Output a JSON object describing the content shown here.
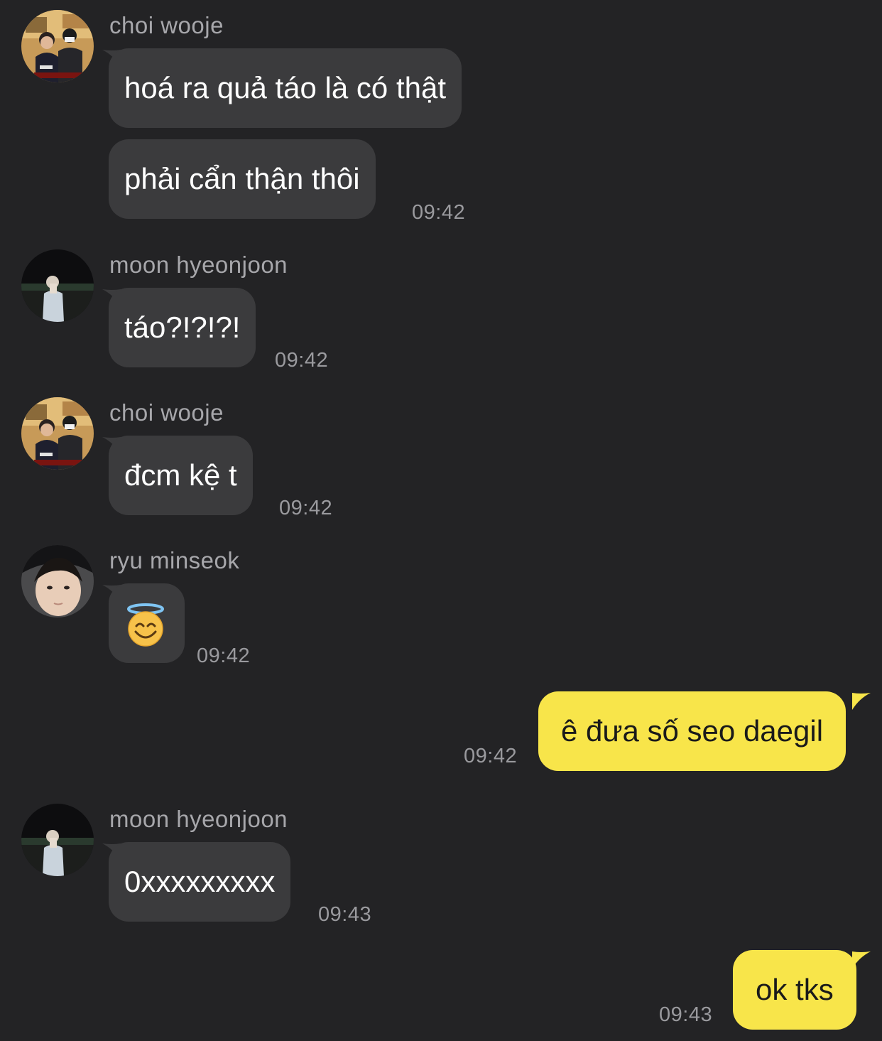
{
  "messages": [
    {
      "sender": "choi wooje",
      "text": "hoá ra quả táo là có thật"
    },
    {
      "text": "phải cẩn thận thôi",
      "time": "09:42"
    },
    {
      "sender": "moon hyeonjoon",
      "text": "táo?!?!?!",
      "time": "09:42"
    },
    {
      "sender": "choi wooje",
      "text": "đcm kệ t",
      "time": "09:42"
    },
    {
      "sender": "ryu minseok",
      "emoji": "smiling-face-with-halo",
      "time": "09:42"
    },
    {
      "outgoing": true,
      "text": "ê đưa số seo daegil",
      "time": "09:42"
    },
    {
      "sender": "moon hyeonjoon",
      "text": "0xxxxxxxxx",
      "time": "09:43"
    },
    {
      "outgoing": true,
      "text": "ok tks",
      "time": "09:43"
    }
  ],
  "colors": {
    "background": "#232325",
    "incoming_bubble": "#3b3b3d",
    "outgoing_bubble": "#f8e54a",
    "timestamp": "#9a9a9e",
    "sender_name": "#a7a7ab"
  }
}
